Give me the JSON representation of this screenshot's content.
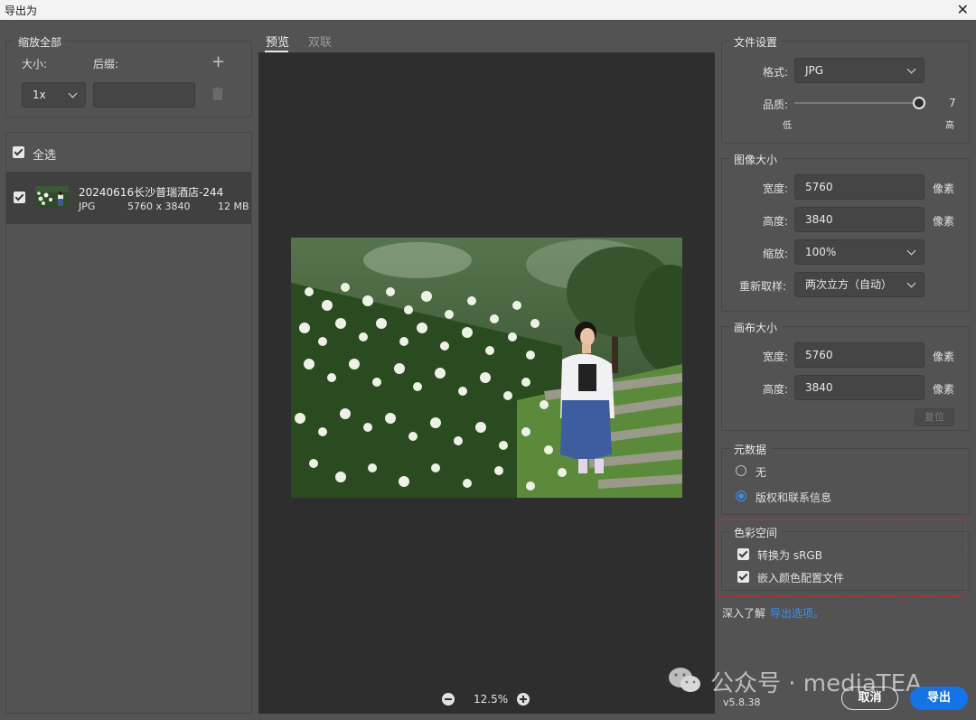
{
  "window": {
    "title": "导出为"
  },
  "scale_all": {
    "legend": "缩放全部",
    "size_label": "大小:",
    "suffix_label": "后缀:",
    "size_value": "1x",
    "suffix_value": ""
  },
  "assets": {
    "select_all_label": "全选",
    "item": {
      "name": "20240616长沙普瑞酒店-244",
      "format": "JPG",
      "dimensions": "5760 x 3840",
      "filesize": "12 MB"
    }
  },
  "tabs": {
    "preview": "预览",
    "artboard": "双联"
  },
  "zoom": {
    "level": "12.5%"
  },
  "file_settings": {
    "legend": "文件设置",
    "format_label": "格式:",
    "format_value": "JPG",
    "quality_label": "品质:",
    "quality_value": "7",
    "quality_fraction": 1.0,
    "low_label": "低",
    "high_label": "高"
  },
  "image_size": {
    "legend": "图像大小",
    "width_label": "宽度:",
    "width_value": "5760",
    "height_label": "高度:",
    "height_value": "3840",
    "unit": "像素",
    "scale_label": "缩放:",
    "scale_value": "100%",
    "resample_label": "重新取样:",
    "resample_value": "两次立方（自动）"
  },
  "canvas_size": {
    "legend": "画布大小",
    "width_label": "宽度:",
    "width_value": "5760",
    "height_label": "高度:",
    "height_value": "3840",
    "unit": "像素",
    "reset_label": "复位"
  },
  "metadata": {
    "legend": "元数据",
    "none_label": "无",
    "copyright_label": "版权和联系信息"
  },
  "color_space": {
    "legend": "色彩空间",
    "convert_label": "转换为 sRGB",
    "embed_label": "嵌入颜色配置文件"
  },
  "learn_more": {
    "prefix": "深入了解",
    "link": "导出选项。"
  },
  "footer": {
    "version": "v5.8.38",
    "watermark": "公众号 · mediaTEA",
    "cancel_label": "取消",
    "export_label": "导出"
  },
  "colors": {
    "accent": "#1473e6",
    "highlight_box": "#d9262b",
    "panel_bg": "#535353",
    "preview_bg": "#2e2e2e"
  }
}
